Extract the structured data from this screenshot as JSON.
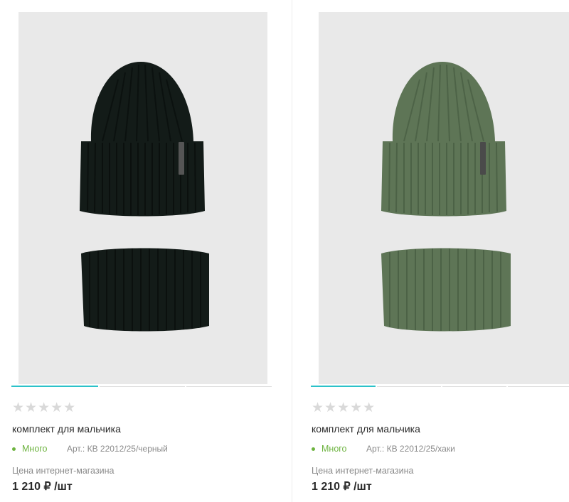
{
  "products": [
    {
      "colors": {
        "knit": "#131b18",
        "knit_dark": "#0a0f0d",
        "tag": "#555555"
      },
      "rating_stars": "★★★★★",
      "title": "комплект для мальчика",
      "stock": "Много",
      "article": "Арт.: КВ 22012/25/черный",
      "price_label": "Цена интернет-магазина",
      "price": "1 210 ₽ /шт"
    },
    {
      "colors": {
        "knit": "#5e7556",
        "knit_dark": "#4a5f44",
        "tag": "#4a4a4a"
      },
      "rating_stars": "★★★★★",
      "title": "комплект для мальчика",
      "stock": "Много",
      "article": "Арт.: КВ 22012/25/хаки",
      "price_label": "Цена интернет-магазина",
      "price": "1 210 ₽ /шт"
    }
  ],
  "accent_color": "#2bc2c9",
  "stock_color": "#6db33f"
}
